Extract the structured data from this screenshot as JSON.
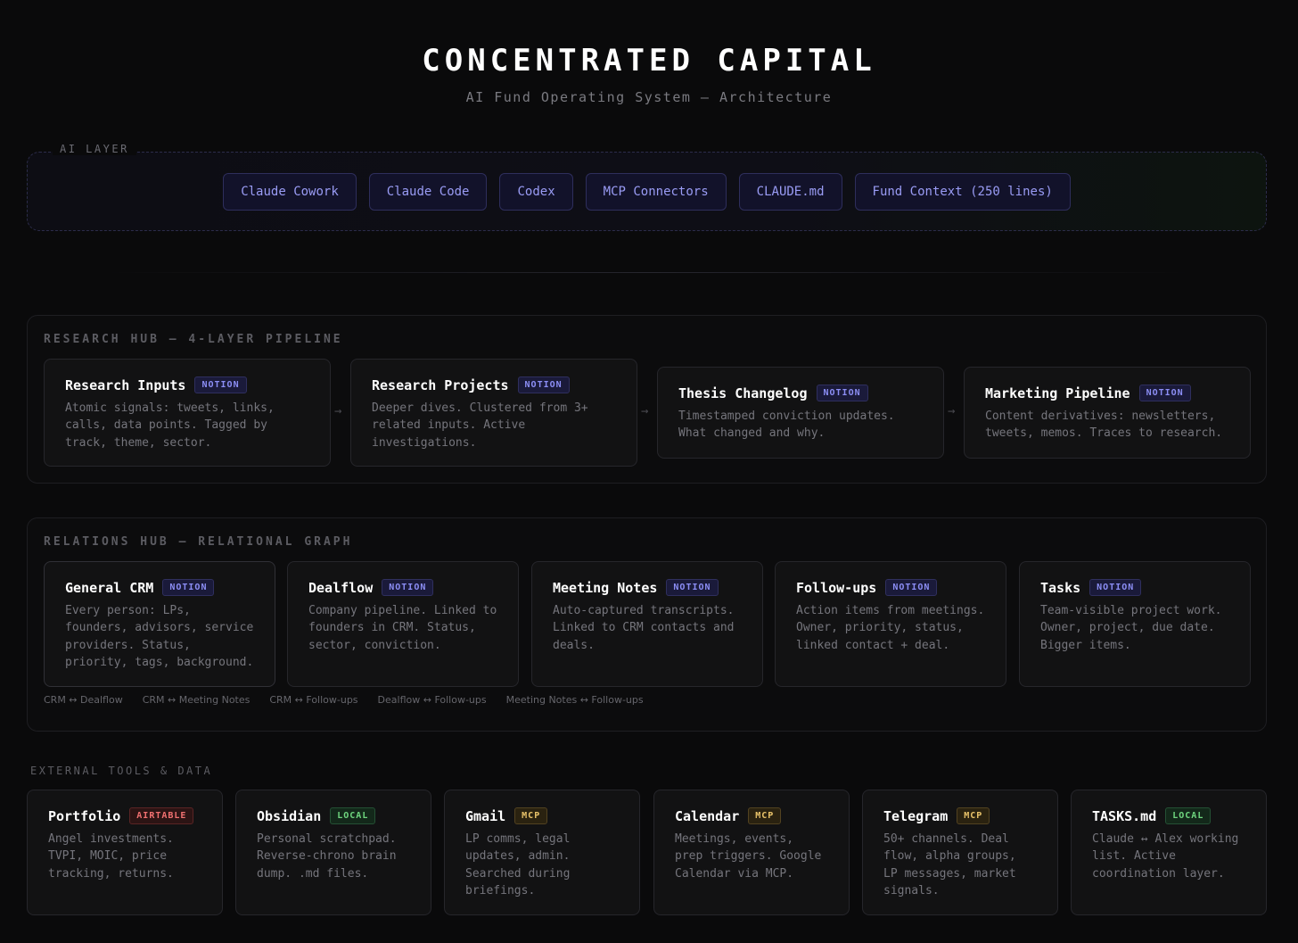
{
  "header": {
    "title": "CONCENTRATED CAPITAL",
    "subtitle": "AI Fund Operating System — Architecture"
  },
  "ai_layer": {
    "label": "AI LAYER",
    "chips": [
      "Claude Cowork",
      "Claude Code",
      "Codex",
      "MCP Connectors",
      "CLAUDE.md",
      "Fund Context (250 lines)"
    ]
  },
  "research_hub": {
    "title": "RESEARCH HUB — 4-LAYER PIPELINE",
    "arrow": "→",
    "cards": [
      {
        "title": "Research Inputs",
        "badge": "NOTION",
        "desc": "Atomic signals: tweets, links, calls, data points. Tagged by track, theme, sector."
      },
      {
        "title": "Research Projects",
        "badge": "NOTION",
        "desc": "Deeper dives. Clustered from 3+ related inputs. Active investigations."
      },
      {
        "title": "Thesis Changelog",
        "badge": "NOTION",
        "desc": "Timestamped conviction updates. What changed and why."
      },
      {
        "title": "Marketing Pipeline",
        "badge": "NOTION",
        "desc": "Content derivatives: newsletters, tweets, memos. Traces to research."
      }
    ]
  },
  "relations_hub": {
    "title": "RELATIONS HUB — RELATIONAL GRAPH",
    "cards": [
      {
        "title": "General CRM",
        "badge": "NOTION",
        "desc": "Every person: LPs, founders, advisors, service providers. Status, priority, tags, background."
      },
      {
        "title": "Dealflow",
        "badge": "NOTION",
        "desc": "Company pipeline. Linked to founders in CRM. Status, sector, conviction."
      },
      {
        "title": "Meeting Notes",
        "badge": "NOTION",
        "desc": "Auto-captured transcripts. Linked to CRM contacts and deals."
      },
      {
        "title": "Follow-ups",
        "badge": "NOTION",
        "desc": "Action items from meetings. Owner, priority, status, linked contact + deal."
      },
      {
        "title": "Tasks",
        "badge": "NOTION",
        "desc": "Team-visible project work. Owner, project, due date. Bigger items."
      }
    ],
    "links": [
      "CRM ↔ Dealflow",
      "CRM ↔ Meeting Notes",
      "CRM ↔ Follow-ups",
      "Dealflow ↔ Follow-ups",
      "Meeting Notes ↔ Follow-ups"
    ]
  },
  "external": {
    "title": "EXTERNAL TOOLS & DATA",
    "cards": [
      {
        "title": "Portfolio",
        "badge": "AIRTABLE",
        "desc": "Angel investments. TVPI, MOIC, price tracking, returns."
      },
      {
        "title": "Obsidian",
        "badge": "LOCAL",
        "desc": "Personal scratchpad. Reverse-chrono brain dump. .md files."
      },
      {
        "title": "Gmail",
        "badge": "MCP",
        "desc": "LP comms, legal updates, admin. Searched during briefings."
      },
      {
        "title": "Calendar",
        "badge": "MCP",
        "desc": "Meetings, events, prep triggers. Google Calendar via MCP."
      },
      {
        "title": "Telegram",
        "badge": "MCP",
        "desc": "50+ channels. Deal flow, alpha groups, LP messages, market signals."
      },
      {
        "title": "TASKS.md",
        "badge": "LOCAL",
        "desc": "Claude ↔ Alex working list. Active coordination layer."
      }
    ]
  }
}
